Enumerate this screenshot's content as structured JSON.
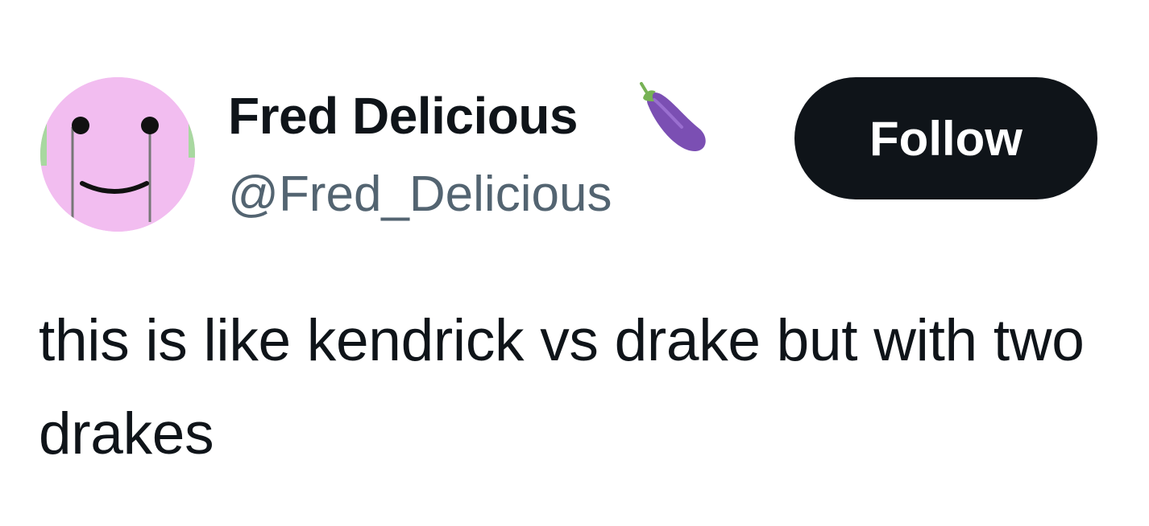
{
  "author": {
    "display_name": "Fred Delicious",
    "name_emoji": "eggplant-icon",
    "handle": "@Fred_Delicious",
    "avatar": "smiley-face-avatar"
  },
  "actions": {
    "follow_label": "Follow"
  },
  "tweet": {
    "text": "this is like kendrick vs drake but with two drakes"
  },
  "colors": {
    "text_primary": "#0f1419",
    "text_secondary": "#536471",
    "button_bg": "#0f1419",
    "button_text": "#ffffff",
    "avatar_bg": "#f2bdf0",
    "eggplant_purple": "#7b4fb3",
    "eggplant_stem": "#77b255"
  }
}
